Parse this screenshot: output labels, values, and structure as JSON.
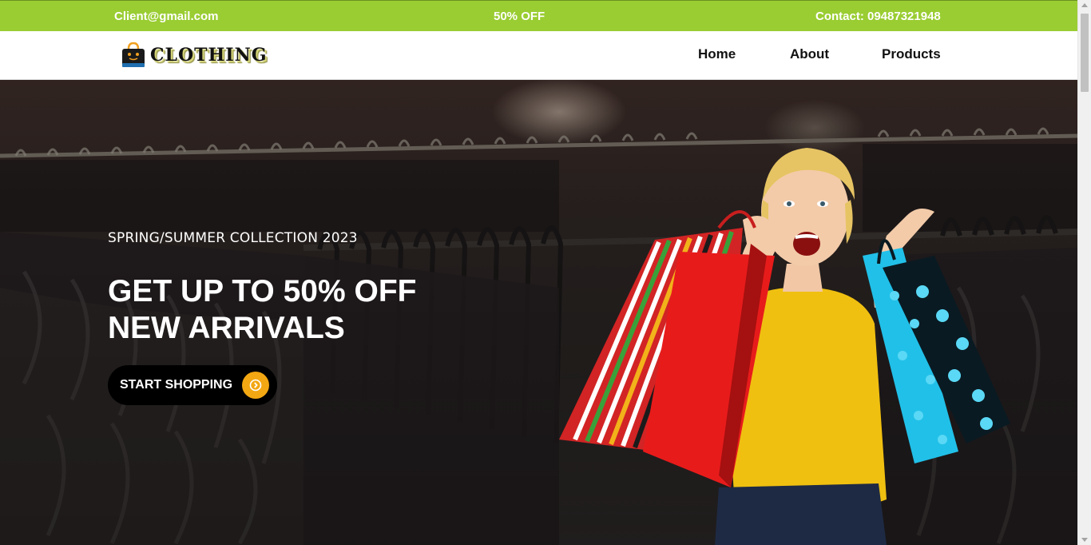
{
  "topbar": {
    "email": "Client@gmail.com",
    "offer": "50% OFF",
    "contact": "Contact: 09487321948"
  },
  "nav": {
    "logo_text": "CLOTHING",
    "links": [
      "Home",
      "About",
      "Products"
    ]
  },
  "hero": {
    "subtitle": "SPRING/SUMMER COLLECTION 2023",
    "title_line1": "GET UP TO 50% OFF",
    "title_line2": "NEW ARRIVALS",
    "cta_label": "START SHOPPING"
  },
  "colors": {
    "topbar_bg": "#9acd32",
    "cta_bg": "#000000",
    "cta_icon_bg": "#f3a712"
  },
  "icons": {
    "logo": "shopping-bag-icon",
    "cta": "chevron-right-circle-icon"
  }
}
